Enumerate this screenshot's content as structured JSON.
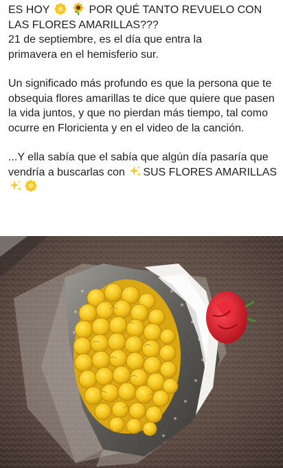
{
  "post": {
    "line1_part1": "ES HOY",
    "line1_part2": "POR QUÉ TANTO REVUELO CON",
    "line2": "LAS FLORES AMARILLAS???",
    "line3": "21 de septiembre, es el día que entra la",
    "line4": "primavera en el hemisferio sur.",
    "para2": "Un significado más profundo es que la persona que te obsequia flores amarillas te dice que quiere que pasen la vida juntos, y que no pierdan más tiempo, tal como ocurre en Floricienta y en el video de la canción.",
    "para3_part1": "...Y ella sabía que el sabía que algún día pasaría que vendría a buscarlas con",
    "para3_part2": "SUS FLORES AMARILLAS",
    "icons": [
      "sunflower-blossom-emoji",
      "sunflower-emoji",
      "sparkles-emoji",
      "sparkles-emoji",
      "sunflower-blossom-emoji"
    ]
  },
  "photo": {
    "subject": "bouquet of yellow roses with a red rose",
    "colors": {
      "roses": "#f2c21a",
      "rug": "#5b4a42",
      "red_rose": "#d81e2a"
    }
  }
}
